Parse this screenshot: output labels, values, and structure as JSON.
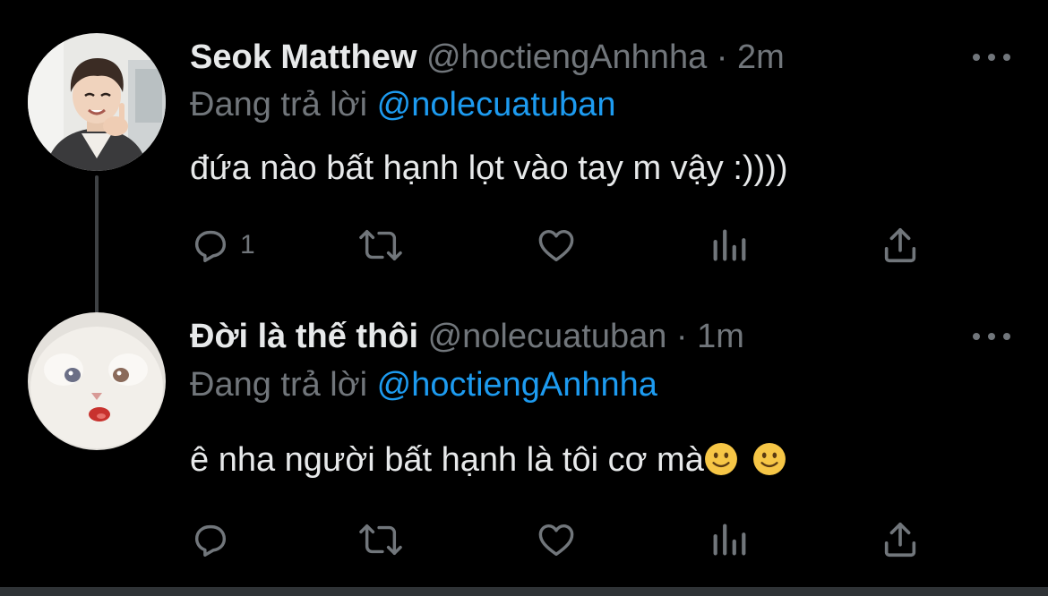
{
  "tweets": [
    {
      "display_name": "Seok Matthew",
      "handle": "@hoctiengAnhnha",
      "separator": "·",
      "time": "2m",
      "reply_prefix": "Đang trả lời",
      "reply_mention": "@nolecuatuban",
      "text": "đứa nào bất hạnh lọt vào tay m vậy :))))",
      "reply_count": "1",
      "avatar": "person-photo-avatar"
    },
    {
      "display_name": "Đời là thế thôi",
      "handle": "@nolecuatuban",
      "separator": "·",
      "time": "1m",
      "reply_prefix": "Đang trả lời",
      "reply_mention": "@hoctiengAnhnha",
      "text": "ê nha người bất hạnh là tôi cơ mà",
      "emojis": [
        "slightly-smiling-face",
        "slightly-smiling-face"
      ],
      "reply_count": "",
      "avatar": "white-cat-photo-avatar"
    }
  ],
  "icons": {
    "reply": "reply-bubble-icon",
    "retweet": "retweet-icon",
    "like": "heart-icon",
    "views": "views-bar-chart-icon",
    "share": "share-upload-icon",
    "more": "more-dots-icon"
  },
  "colors": {
    "background": "#000000",
    "primary_text": "#e7e9ea",
    "secondary_text": "#71767b",
    "accent": "#1d9bf0",
    "connector": "#3e4144"
  }
}
